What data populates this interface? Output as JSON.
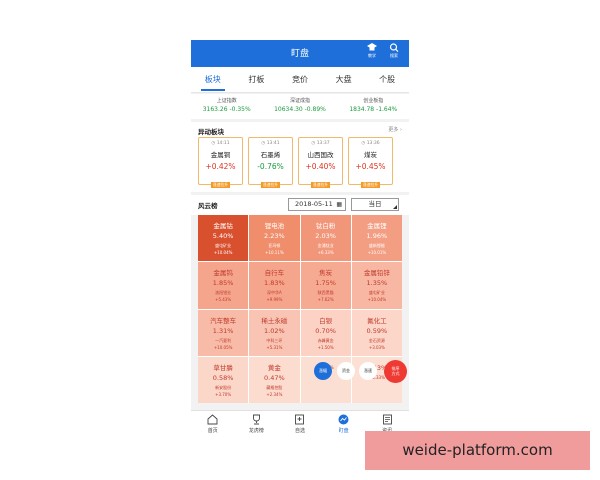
{
  "header": {
    "title": "盯盘",
    "teach_label": "教学",
    "search_label": "搜索"
  },
  "tabs": [
    {
      "label": "板块",
      "active": true
    },
    {
      "label": "打板",
      "active": false
    },
    {
      "label": "竞价",
      "active": false
    },
    {
      "label": "大盘",
      "active": false
    },
    {
      "label": "个股",
      "active": false
    }
  ],
  "indices": [
    {
      "name": "上证指数",
      "value": "3163.26 -0.35%"
    },
    {
      "name": "深证成指",
      "value": "10634.30 -0.89%"
    },
    {
      "name": "创业板指",
      "value": "1834.78 -1.64%"
    }
  ],
  "unusual": {
    "title": "异动板块",
    "more_label": "更多",
    "cards": [
      {
        "time": "14:11",
        "name": "金属铜",
        "pct": "+0.42%",
        "tag": "涨速拉升",
        "dir": "up"
      },
      {
        "time": "13:41",
        "name": "石墨烯",
        "pct": "-0.76%",
        "tag": "涨速拉升",
        "dir": "down"
      },
      {
        "time": "13:37",
        "name": "山西国改",
        "pct": "+0.40%",
        "tag": "涨速拉升",
        "dir": "up"
      },
      {
        "time": "13:36",
        "name": "煤炭",
        "pct": "+0.45%",
        "tag": "涨速拉升",
        "dir": "up"
      }
    ]
  },
  "board": {
    "title": "风云榜",
    "date": "2018-05-11",
    "period": "当日",
    "cells": [
      {
        "name": "金属钴",
        "pct": "5.40%",
        "stock": "盛屯矿业",
        "stock_pct": "+10.04%",
        "bg": "#d8502e",
        "fg": "#ffffff"
      },
      {
        "name": "锂电池",
        "pct": "2.23%",
        "stock": "亚玛顿",
        "stock_pct": "+10.11%",
        "bg": "#f08d6b",
        "fg": "#ffffff"
      },
      {
        "name": "钛白粉",
        "pct": "2.03%",
        "stock": "金浦钛业",
        "stock_pct": "+6.33%",
        "bg": "#f2967a",
        "fg": "#ffffff"
      },
      {
        "name": "金属锂",
        "pct": "1.96%",
        "stock": "盛新锂能",
        "stock_pct": "+10.01%",
        "bg": "#f39d83",
        "fg": "#ffffff"
      },
      {
        "name": "金属钨",
        "pct": "1.85%",
        "stock": "洛阳钼业",
        "stock_pct": "+5.43%",
        "bg": "#f5a58c",
        "fg": "#c0392b"
      },
      {
        "name": "自行车",
        "pct": "1.83%",
        "stock": "深中华A",
        "stock_pct": "+9.99%",
        "bg": "#f5a58c",
        "fg": "#c0392b"
      },
      {
        "name": "焦炭",
        "pct": "1.75%",
        "stock": "陕西黑猫",
        "stock_pct": "+7.62%",
        "bg": "#f6aa92",
        "fg": "#c0392b"
      },
      {
        "name": "金属铅锌",
        "pct": "1.35%",
        "stock": "盛屯矿业",
        "stock_pct": "+10.04%",
        "bg": "#f8b7a2",
        "fg": "#c0392b"
      },
      {
        "name": "汽车整车",
        "pct": "1.31%",
        "stock": "一汽夏利",
        "stock_pct": "+10.05%",
        "bg": "#f8bba7",
        "fg": "#c0392b"
      },
      {
        "name": "稀土永磁",
        "pct": "1.02%",
        "stock": "中科三环",
        "stock_pct": "+5.31%",
        "bg": "#f9c4b3",
        "fg": "#c0392b"
      },
      {
        "name": "白银",
        "pct": "0.70%",
        "stock": "赤峰黄金",
        "stock_pct": "+1.50%",
        "bg": "#fbd2c4",
        "fg": "#c0392b"
      },
      {
        "name": "氟化工",
        "pct": "0.59%",
        "stock": "金石资源",
        "stock_pct": "+3.03%",
        "bg": "#fbd6c9",
        "fg": "#c0392b"
      },
      {
        "name": "草甘膦",
        "pct": "0.58%",
        "stock": "新安股份",
        "stock_pct": "+3.70%",
        "bg": "#fbd7ca",
        "fg": "#c0392b"
      },
      {
        "name": "黄金",
        "pct": "0.47%",
        "stock": "藏格控股",
        "stock_pct": "+2.34%",
        "bg": "#fcdccf",
        "fg": "#c0392b"
      },
      {
        "name": "",
        "pct": "",
        "stock": "",
        "stock_pct": "+3.09%",
        "bg": "#fcdfd3",
        "fg": "#c0392b"
      },
      {
        "name": "",
        "pct": "0.43%",
        "stock": "",
        "stock_pct": "+5.33%",
        "bg": "#fce0d4",
        "fg": "#c0392b"
      }
    ]
  },
  "floating": {
    "blue_label": "涨幅",
    "w1_label": "资金",
    "w2_label": "涨速",
    "red_line1": "排序",
    "red_line2": "方式"
  },
  "bottom_nav": [
    {
      "label": "首页",
      "icon": "home-icon",
      "active": false
    },
    {
      "label": "龙虎榜",
      "icon": "trophy-icon",
      "active": false
    },
    {
      "label": "自选",
      "icon": "bookmark-icon",
      "active": false
    },
    {
      "label": "盯盘",
      "icon": "chart-icon",
      "active": true
    },
    {
      "label": "资讯",
      "icon": "news-icon",
      "active": false
    }
  ],
  "watermark": "weide-platform.com",
  "colors": {
    "accent": "#1e6fd9",
    "up": "#e0321e",
    "down": "#1a9b3c",
    "tag": "#f39b2a"
  }
}
